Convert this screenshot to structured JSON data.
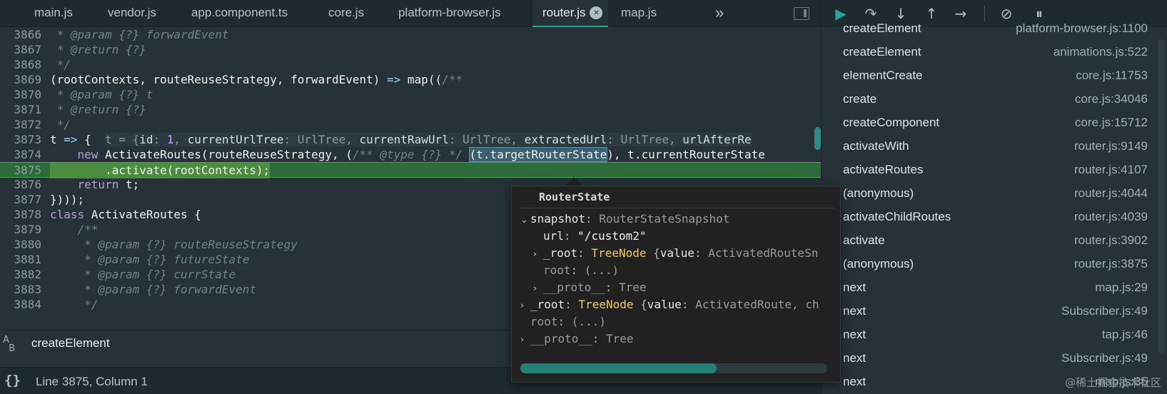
{
  "tabs": [
    {
      "label": "main.js",
      "active": false
    },
    {
      "label": "vendor.js",
      "active": false
    },
    {
      "label": "app.component.ts",
      "active": false
    },
    {
      "label": "core.js",
      "active": false
    },
    {
      "label": "platform-browser.js",
      "active": false
    },
    {
      "label": "router.js",
      "active": true
    },
    {
      "label": "map.js",
      "active": false
    }
  ],
  "tab_overflow_glyph": "»",
  "code": {
    "lines": [
      {
        "num": "3866",
        "text": " * @param {?} forwardEvent"
      },
      {
        "num": "3867",
        "text": " * @return {?}"
      },
      {
        "num": "3868",
        "text": " */"
      },
      {
        "num": "3869",
        "pre": "(rootContexts, routeReuseStrategy, forwardEvent) ",
        "arrow": "=>",
        "call": " map((",
        "comment": "/**"
      },
      {
        "num": "3870",
        "text": " * @param {?} t"
      },
      {
        "num": "3871",
        "text": " * @return {?}"
      },
      {
        "num": "3872",
        "text": " */"
      },
      {
        "num": "3873",
        "pre": "t ",
        "arrow": "=>",
        "post": " {"
      },
      {
        "num": "3874",
        "indent": "    ",
        "kw": "new",
        "pre": " ActivateRoutes(routeReuseStrategy, (",
        "comment": "/** @type {?} */",
        "space": " ",
        "hl": "(t.targetRouterState",
        "post": "), t.currentRouterState"
      },
      {
        "num": "3875",
        "text": "        .activate(rootContexts);"
      },
      {
        "num": "3876",
        "indent": "    ",
        "kw": "return",
        "post": " t;"
      },
      {
        "num": "3877",
        "text": "})));"
      },
      {
        "num": "3878",
        "kw": "class",
        "post": " ActivateRoutes {"
      },
      {
        "num": "3879",
        "text": "    /**"
      },
      {
        "num": "3880",
        "text": "     * @param {?} routeReuseStrategy"
      },
      {
        "num": "3881",
        "text": "     * @param {?} futureState"
      },
      {
        "num": "3882",
        "text": "     * @param {?} currState"
      },
      {
        "num": "3883",
        "text": "     * @param {?} forwardEvent"
      },
      {
        "num": "3884",
        "text": "     */"
      }
    ],
    "inline_value": {
      "open": "t = {",
      "k1": "id",
      "v1": "1",
      "k2": "currentUrlTree",
      "t2": "UrlTree",
      "k3": "currentRawUrl",
      "t3": "UrlTree",
      "k4": "extractedUrl",
      "t4": "UrlTree",
      "k5": "urlAfterRe"
    }
  },
  "search": {
    "value": "createElement"
  },
  "status": {
    "text": "Line 3875, Column 1",
    "braces": "{}"
  },
  "popover": {
    "title": "RouterState",
    "rows": [
      {
        "chev": "⌄",
        "key": "snapshot",
        "sep": ": ",
        "type": "RouterStateSnapshot"
      },
      {
        "key": "url",
        "sep": ": ",
        "str": "\"/custom2\""
      },
      {
        "chev": "›",
        "key": "_root",
        "sep": ": ",
        "cls": "TreeNode",
        "rest_open": " {",
        "rest_key": "value",
        "rest_sep": ": ",
        "rest_type": "ActivatedRouteSn"
      },
      {
        "key": "root",
        "sep": ": ",
        "type": "(...)"
      },
      {
        "chev": "›",
        "key": "__proto__",
        "sep": ": ",
        "type": "Tree"
      },
      {
        "chev": "›",
        "key": "_root",
        "sep": ": ",
        "cls": "TreeNode",
        "rest_open": " {",
        "rest_key": "value",
        "rest_sep": ": ",
        "rest_type": "ActivatedRoute, ch"
      },
      {
        "key": "root",
        "sep": ": ",
        "type": "(...)"
      },
      {
        "chev": "›",
        "key": "__proto__",
        "sep": ": ",
        "type": "Tree"
      }
    ]
  },
  "call_stack": [
    {
      "fn": "createElement",
      "loc": "platform-browser.js:1100"
    },
    {
      "fn": "createElement",
      "loc": "animations.js:522"
    },
    {
      "fn": "elementCreate",
      "loc": "core.js:11753"
    },
    {
      "fn": "create",
      "loc": "core.js:34046"
    },
    {
      "fn": "createComponent",
      "loc": "core.js:15712"
    },
    {
      "fn": "activateWith",
      "loc": "router.js:9149"
    },
    {
      "fn": "activateRoutes",
      "loc": "router.js:4107"
    },
    {
      "fn": "(anonymous)",
      "loc": "router.js:4044"
    },
    {
      "fn": "activateChildRoutes",
      "loc": "router.js:4039"
    },
    {
      "fn": "activate",
      "loc": "router.js:3902"
    },
    {
      "fn": "(anonymous)",
      "loc": "router.js:3875"
    },
    {
      "fn": "next",
      "loc": "map.js:29"
    },
    {
      "fn": "next",
      "loc": "Subscriber.js:49"
    },
    {
      "fn": "next",
      "loc": "tap.js:46"
    },
    {
      "fn": "next",
      "loc": "Subscriber.js:49"
    },
    {
      "fn": "next",
      "loc": "map.js:35"
    }
  ],
  "watermark": "@稀土掘金技术社区",
  "colors": {
    "accent": "#26a69a",
    "exec_line": "#2e6b3a",
    "background": "#263238"
  }
}
